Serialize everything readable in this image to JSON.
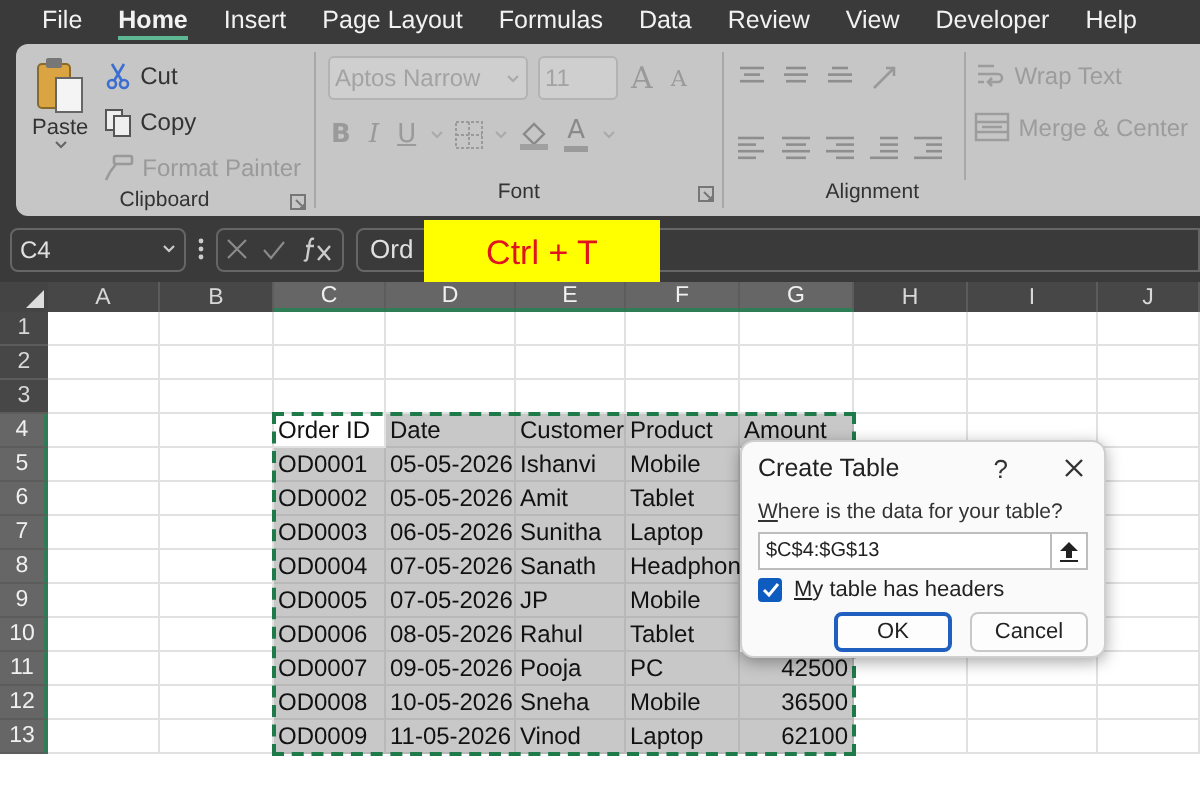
{
  "menu_tabs": [
    {
      "label": "File",
      "selected": false
    },
    {
      "label": "Home",
      "selected": true
    },
    {
      "label": "Insert",
      "selected": false
    },
    {
      "label": "Page Layout",
      "selected": false
    },
    {
      "label": "Formulas",
      "selected": false
    },
    {
      "label": "Data",
      "selected": false
    },
    {
      "label": "Review",
      "selected": false
    },
    {
      "label": "View",
      "selected": false
    },
    {
      "label": "Developer",
      "selected": false
    },
    {
      "label": "Help",
      "selected": false
    }
  ],
  "clipboard": {
    "label": "Clipboard",
    "paste": "Paste",
    "items": [
      {
        "kind": "cut",
        "label": "Cut",
        "disabled": false
      },
      {
        "kind": "copy",
        "label": "Copy",
        "disabled": false
      },
      {
        "kind": "painter",
        "label": "Format Painter",
        "disabled": true
      }
    ]
  },
  "font": {
    "label": "Font",
    "font_name": "Aptos Narrow",
    "font_size": "11",
    "size_buttons": [
      "A",
      "A"
    ],
    "style_buttons": [
      "B",
      "I",
      "U"
    ],
    "color_button": "A"
  },
  "alignment": {
    "label": "Alignment",
    "items": [
      {
        "kind": "wrap",
        "label": "Wrap Text",
        "disabled": true
      },
      {
        "kind": "merge",
        "label": "Merge & Center",
        "disabled": true
      }
    ]
  },
  "formula_bar": {
    "name_box": "C4",
    "formula": "Ord"
  },
  "overlay_caption": "Ctrl + T",
  "sheet": {
    "columns": [
      {
        "label": "A",
        "selected": false
      },
      {
        "label": "B",
        "selected": false
      },
      {
        "label": "C",
        "selected": true
      },
      {
        "label": "D",
        "selected": true
      },
      {
        "label": "E",
        "selected": true
      },
      {
        "label": "F",
        "selected": true
      },
      {
        "label": "G",
        "selected": true
      },
      {
        "label": "H",
        "selected": false
      },
      {
        "label": "I",
        "selected": false
      },
      {
        "label": "J",
        "selected": false
      }
    ],
    "rows": [
      {
        "label": "1",
        "selected": false,
        "cells": []
      },
      {
        "label": "2",
        "selected": false,
        "cells": []
      },
      {
        "label": "3",
        "selected": false,
        "cells": []
      },
      {
        "label": "4",
        "selected": true,
        "cells": [
          "",
          "",
          "Order ID",
          "Date",
          "Customer",
          "Product",
          "Amount"
        ]
      },
      {
        "label": "5",
        "selected": true,
        "cells": [
          "",
          "",
          "OD0001",
          "05-05-2026",
          "Ishanvi",
          "Mobile"
        ]
      },
      {
        "label": "6",
        "selected": true,
        "cells": [
          "",
          "",
          "OD0002",
          "05-05-2026",
          "Amit",
          "Tablet"
        ]
      },
      {
        "label": "7",
        "selected": true,
        "cells": [
          "",
          "",
          "OD0003",
          "06-05-2026",
          "Sunitha",
          "Laptop"
        ]
      },
      {
        "label": "8",
        "selected": true,
        "cells": [
          "",
          "",
          "OD0004",
          "07-05-2026",
          "Sanath",
          "Headphon"
        ]
      },
      {
        "label": "9",
        "selected": true,
        "cells": [
          "",
          "",
          "OD0005",
          "07-05-2026",
          "JP",
          "Mobile"
        ]
      },
      {
        "label": "10",
        "selected": true,
        "cells": [
          "",
          "",
          "OD0006",
          "08-05-2026",
          "Rahul",
          "Tablet"
        ]
      },
      {
        "label": "11",
        "selected": true,
        "cells": [
          "",
          "",
          "OD0007",
          "09-05-2026",
          "Pooja",
          "PC",
          "42500"
        ]
      },
      {
        "label": "12",
        "selected": true,
        "cells": [
          "",
          "",
          "OD0008",
          "10-05-2026",
          "Sneha",
          "Mobile",
          "36500"
        ]
      },
      {
        "label": "13",
        "selected": true,
        "cells": [
          "",
          "",
          "OD0009",
          "11-05-2026",
          "Vinod",
          "Laptop",
          "62100"
        ]
      }
    ]
  },
  "dialog": {
    "title": "Create Table",
    "help": "?",
    "prompt": "Where is the data for your table?",
    "range": "$C$4:$G$13",
    "checkbox": {
      "label": "My table has headers",
      "checked": true
    },
    "buttons": [
      {
        "label": "OK",
        "default": true
      },
      {
        "label": "Cancel",
        "default": false
      }
    ]
  }
}
